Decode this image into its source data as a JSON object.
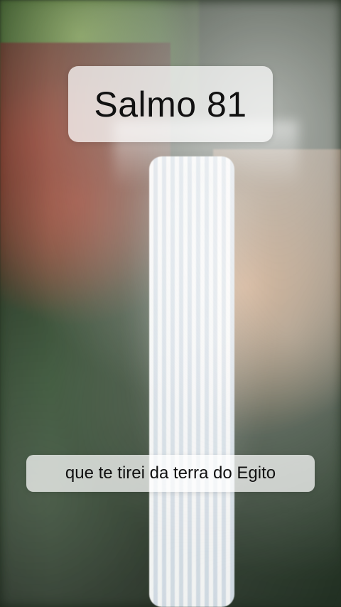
{
  "overlay": {
    "title": "Salmo 81",
    "caption": "que te tirei da terra do Egito"
  },
  "colors": {
    "overlay_bg": "#ffffff",
    "overlay_text": "#111111"
  }
}
